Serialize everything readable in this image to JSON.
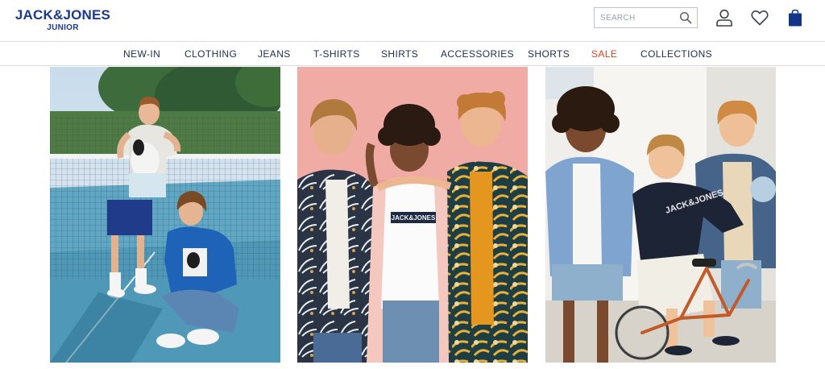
{
  "brand": {
    "name": "JACK&JONES",
    "sub": "JUNIOR",
    "color": "#1b3a8c"
  },
  "search": {
    "placeholder": "SEARCH",
    "value": ""
  },
  "header_icons": [
    "search-icon",
    "account-icon",
    "heart-icon",
    "shopping-bag-icon"
  ],
  "nav": {
    "items": [
      {
        "label": "NEW-IN"
      },
      {
        "label": "CLOTHING"
      },
      {
        "label": "JEANS"
      },
      {
        "label": "T-SHIRTS"
      },
      {
        "label": "SHIRTS"
      },
      {
        "label": "ACCESSORIES"
      },
      {
        "label": "SHORTS"
      },
      {
        "label": "SALE"
      },
      {
        "label": "COLLECTIONS"
      }
    ],
    "sale_color": "#e2411d"
  },
  "tiles": [
    {
      "scene": "tennis-court",
      "shirt_print": ""
    },
    {
      "scene": "pink-wall",
      "shirt_print": "JACK&JONES"
    },
    {
      "scene": "white-wall-bicycle",
      "shirt_print": "JACK&JONES"
    }
  ]
}
